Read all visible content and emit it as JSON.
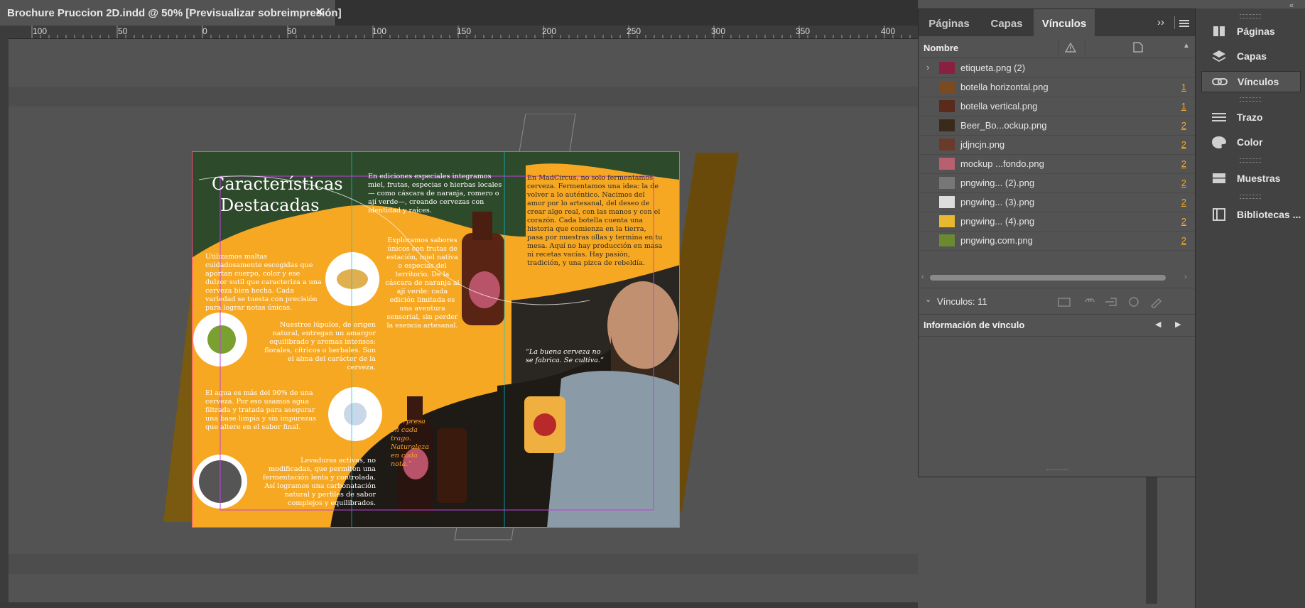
{
  "document": {
    "tab_title": "Brochure Pruccion 2D.indd @ 50% [Previsualizar sobreimpresión]",
    "close_glyph": "✕"
  },
  "ruler": {
    "labels": [
      "100",
      "50",
      "0",
      "50",
      "100",
      "150",
      "200",
      "250",
      "300",
      "350",
      "400"
    ]
  },
  "brochure": {
    "heading_line1": "Características",
    "heading_line2": "Destacadas",
    "p_maltas": "Utilizamos maltas cuidadosamente escogidas que aportan cuerpo, color y ese dulzor sutil que caracteriza a una cerveza bien hecha. Cada variedad se tuesta con precisión para lograr notas únicas.",
    "p_lupulos": "Nuestros lúpulos, de origen natural, entregan un amargor equilibrado y aromas intensos: florales, cítricos o herbales. Son el alma del carácter de la cerveza.",
    "p_agua": "El agua es más del 90% de una cerveza. Por eso usamos agua filtrada y tratada para asegurar una base limpia y sin impurezas que altere en el sabor final.",
    "p_levaduras": "Levaduras activas, no modificadas, que permiten una fermentación lenta y controlada. Así logramos una carbonatación natural y perfiles de sabor complejos y equilibrados.",
    "p_ediciones": "En ediciones especiales integramos miel, frutas, especias o hierbas locales — como cáscara de naranja, romero o ají verde—, creando cervezas con identidad y raíces.",
    "p_exploramos": "Exploramos sabores únicos con frutas de estación, miel nativa o especias del territorio. De la cáscara de naranja al ají verde: cada edición limitada es una aventura sensorial, sin perder la esencia artesanal.",
    "p_sorpresa": "“Sorpresa en cada trago. Naturaleza en cada nota.”",
    "p_madcircus": "En MadCircus, no solo fermentamos cerveza. Fermentamos una idea: la de volver a lo auténtico. Nacimos del amor por lo artesanal, del deseo de crear algo real, con las manos y con el corazón. Cada botella cuenta una historia que comienza en la tierra, pasa por nuestras ollas y termina en tu mesa. Aquí no hay producción en masa ni recetas vacías. Hay pasión, tradición, y una pizca de rebeldía.",
    "p_quote": "“La buena cerveza no se fabrica. Se cultiva.”",
    "colors": {
      "orange": "#f7a823",
      "green": "#2d4a2a",
      "dark": "#1e1a16"
    }
  },
  "panel": {
    "tabs": [
      "Páginas",
      "Capas",
      "Vínculos"
    ],
    "active_tab": "Vínculos",
    "column_name": "Nombre",
    "links": [
      {
        "name": "etiqueta.png (2)",
        "page": "",
        "expandable": true,
        "thumb": "#8a2040"
      },
      {
        "name": "botella horizontal.png",
        "page": "1",
        "thumb": "#7a4a20"
      },
      {
        "name": "botella vertical.png",
        "page": "1",
        "thumb": "#5a2a1a"
      },
      {
        "name": "Beer_Bo...ockup.png",
        "page": "2",
        "thumb": "#3a2a1a"
      },
      {
        "name": "jdjncjn.png",
        "page": "2",
        "thumb": "#6a3a2a"
      },
      {
        "name": "mockup ...fondo.png",
        "page": "2",
        "thumb": "#b86070"
      },
      {
        "name": "pngwing... (2).png",
        "page": "2",
        "thumb": "#777777"
      },
      {
        "name": "pngwing... (3).png",
        "page": "2",
        "thumb": "#dddddd"
      },
      {
        "name": "pngwing... (4).png",
        "page": "2",
        "thumb": "#e8b830"
      },
      {
        "name": "pngwing.com.png",
        "page": "2",
        "thumb": "#6a8a30"
      }
    ],
    "links_count_label": "Vínculos: 11",
    "info_label": "Información de vínculo"
  },
  "dock": {
    "items": [
      {
        "label": "Páginas",
        "icon": "pages-icon"
      },
      {
        "label": "Capas",
        "icon": "layers-icon"
      },
      {
        "label": "Vínculos",
        "icon": "links-icon"
      },
      {
        "label": "Trazo",
        "icon": "stroke-icon"
      },
      {
        "label": "Color",
        "icon": "color-icon"
      },
      {
        "label": "Muestras",
        "icon": "swatches-icon"
      },
      {
        "label": "Bibliotecas ...",
        "icon": "libraries-icon"
      }
    ],
    "active": "Vínculos"
  }
}
